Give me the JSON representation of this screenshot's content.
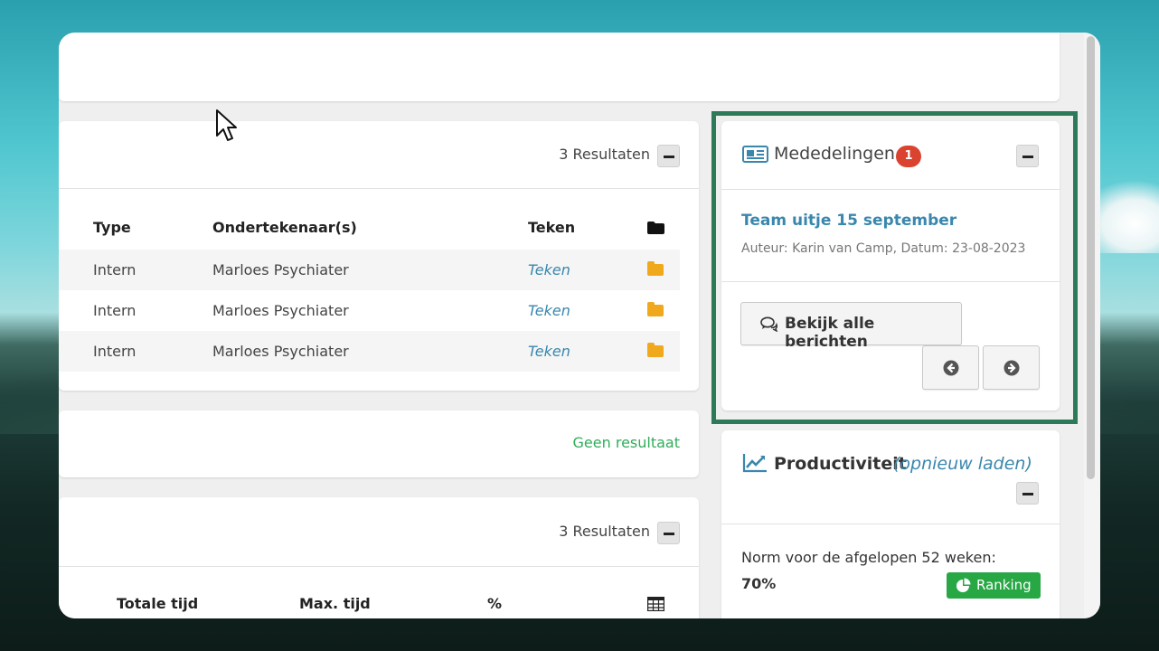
{
  "documents": {
    "count": "3 Resultaten",
    "columns": [
      "Type",
      "Ondertekenaar(s)",
      "Teken"
    ],
    "rows": [
      {
        "type": "Intern",
        "signer": "Marloes Psychiater",
        "action": "Teken"
      },
      {
        "type": "Intern",
        "signer": "Marloes Psychiater",
        "action": "Teken"
      },
      {
        "type": "Intern",
        "signer": "Marloes Psychiater",
        "action": "Teken"
      }
    ]
  },
  "empty_panel": {
    "text": "Geen resultaat"
  },
  "time_panel": {
    "count": "3 Resultaten",
    "columns": [
      "Totale tijd",
      "Max. tijd",
      "%"
    ]
  },
  "announcements": {
    "title": "Mededelingen",
    "badge": "1",
    "item_title": "Team uitje 15 september",
    "item_meta": "Auteur: Karin van Camp, Datum: 23-08-2023",
    "view_all_label": "Bekijk alle berichten"
  },
  "productivity": {
    "title": "Productiviteit",
    "reload": "(opnieuw laden)",
    "norm_label": "Norm voor de afgelopen 52 weken:",
    "norm_value": "70%",
    "ranking_label": "Ranking"
  },
  "icons": [
    "folder-icon",
    "newspaper-icon",
    "comments-icon",
    "arrow-left-circle-icon",
    "arrow-right-circle-icon",
    "line-chart-icon",
    "pie-chart-icon",
    "table-icon",
    "mouse-cursor-icon"
  ],
  "colors": {
    "link": "#3a87ad",
    "success": "#28a745",
    "folder": "#f0a81c",
    "badge": "#d9432f",
    "highlight": "#2d7a58"
  }
}
